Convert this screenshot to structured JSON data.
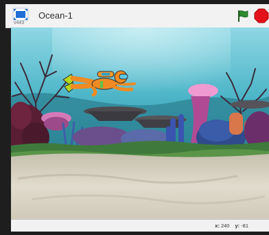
{
  "header": {
    "version": "v443",
    "project_title": "Ocean-1"
  },
  "icons": {
    "stage_mode": "presentation-mode-icon",
    "go": "green-flag-icon",
    "stop": "stop-sign-icon"
  },
  "colors": {
    "green_flag": "#2e8b2e",
    "stop": "#e4101a",
    "stage_mode": "#1f6fd6"
  },
  "stage": {
    "backdrop": "underwater coral reef",
    "sprite": "diver"
  },
  "mouse": {
    "x_label": "x:",
    "x_value": "240",
    "y_label": "y:",
    "y_value": "-81"
  }
}
